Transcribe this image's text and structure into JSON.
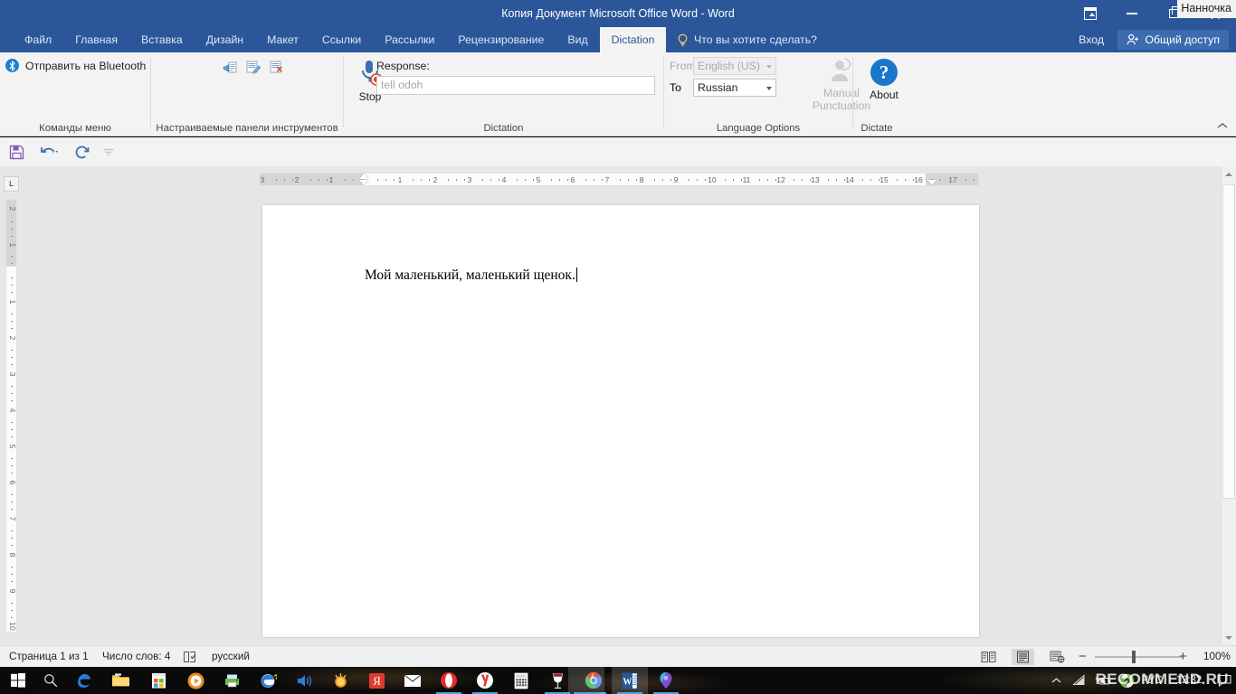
{
  "titlebar": {
    "title": "Копия Документ Microsoft Office Word - Word",
    "name_badge": "Нанночка",
    "ribbon_display_options_icon": "ribbon-display-options-icon",
    "minimize_icon": "minimize-icon",
    "restore_icon": "restore-icon",
    "close_icon": "close-icon"
  },
  "tabs": [
    {
      "label": "Файл",
      "active": false
    },
    {
      "label": "Главная",
      "active": false
    },
    {
      "label": "Вставка",
      "active": false
    },
    {
      "label": "Дизайн",
      "active": false
    },
    {
      "label": "Макет",
      "active": false
    },
    {
      "label": "Ссылки",
      "active": false
    },
    {
      "label": "Рассылки",
      "active": false
    },
    {
      "label": "Рецензирование",
      "active": false
    },
    {
      "label": "Вид",
      "active": false
    },
    {
      "label": "Dictation",
      "active": true
    }
  ],
  "tell_me": {
    "label": "Что вы хотите сделать?",
    "icon": "lightbulb-icon"
  },
  "signin": {
    "label": "Вход"
  },
  "share": {
    "label": "Общий доступ",
    "icon": "share-person-icon"
  },
  "ribbon": {
    "groups": [
      {
        "name": "menu-commands",
        "label": "Команды меню"
      },
      {
        "name": "custom-toolbars",
        "label": "Настраиваемые панели инструментов"
      },
      {
        "name": "dictation",
        "label": "Dictation"
      },
      {
        "name": "language-options",
        "label": "Language Options"
      },
      {
        "name": "dictate",
        "label": "Dictate"
      }
    ],
    "bluetooth": {
      "label": "Отправить на Bluetooth",
      "icon": "bluetooth-icon"
    },
    "custom_toolbar_icons": [
      "send-to-icon",
      "edit-toolbar-icon",
      "delete-toolbar-icon"
    ],
    "dictation": {
      "stop_label": "Stop",
      "stop_icon": "microphone-stop-icon",
      "response_label": "Response:",
      "response_value": "tell odoh"
    },
    "language": {
      "from_label": "From",
      "from_value": "English (US)",
      "to_label": "To",
      "to_value": "Russian",
      "manual_punctuation_line1": "Manual",
      "manual_punctuation_line2": "Punctuation",
      "manual_punctuation_icon": "person-speech-icon"
    },
    "about": {
      "label": "About",
      "icon": "question-mark-icon"
    },
    "collapse_icon": "chevron-up-icon"
  },
  "qat": {
    "save_icon": "save-icon",
    "undo_icon": "undo-icon",
    "undo_dropdown_icon": "chevron-down-icon",
    "redo_icon": "redo-icon",
    "customize_icon": "customize-qat-icon"
  },
  "ruler": {
    "tab_stop_label": "L",
    "horizontal_ticks": [
      "3",
      "2",
      "1",
      "1",
      "2",
      "3",
      "4",
      "5",
      "6",
      "7",
      "8",
      "9",
      "10",
      "11",
      "12",
      "13",
      "14",
      "15",
      "16",
      "17"
    ],
    "vertical_ticks": [
      "2",
      "1",
      "1",
      "2",
      "3",
      "4",
      "5",
      "6",
      "7",
      "8",
      "9",
      "10"
    ],
    "left_indent_marker": "left-indent-marker",
    "right_indent_marker": "right-indent-marker"
  },
  "document": {
    "text": "Мой маленький, маленький щенок."
  },
  "statusbar": {
    "page": "Страница 1 из 1",
    "words": "Число слов: 4",
    "proofing_icon": "proofing-errors-icon",
    "language": "русский",
    "view_read": "read-mode-icon",
    "view_print": "print-layout-icon",
    "view_web": "web-layout-icon",
    "zoom_out": "−",
    "zoom_in": "+",
    "zoom_level": "100%"
  },
  "taskbar": {
    "start_icon": "windows-start-icon",
    "search_icon": "search-icon",
    "items": [
      {
        "name": "edge-icon",
        "running": false
      },
      {
        "name": "file-explorer-icon",
        "running": false
      },
      {
        "name": "microsoft-store-icon",
        "running": false
      },
      {
        "name": "media-player-icon",
        "running": false
      },
      {
        "name": "printer-icon",
        "running": false
      },
      {
        "name": "internet-explorer-icon",
        "running": false
      },
      {
        "name": "volume-app-icon",
        "running": false
      },
      {
        "name": "sun-app-icon",
        "running": false
      },
      {
        "name": "yandex-browser-icon",
        "running": false
      },
      {
        "name": "mail-icon",
        "running": false
      },
      {
        "name": "opera-browser-icon",
        "running": true
      },
      {
        "name": "yandex-disk-icon",
        "running": true
      },
      {
        "name": "calculator-icon",
        "running": false
      },
      {
        "name": "wine-glass-icon",
        "running": true
      },
      {
        "name": "chrome-browser-icon",
        "running": true
      },
      {
        "name": "word-icon",
        "running": true,
        "active": true
      },
      {
        "name": "maps-icon",
        "running": true
      }
    ],
    "tray": {
      "show_hidden_icon": "chevron-up-icon",
      "network_icon": "wifi-icon",
      "power_icon": "battery-icon",
      "app_icon": "tray-app-icon",
      "language": "РУС",
      "time": "12:32",
      "action_center_icon": "action-center-icon"
    }
  },
  "watermark": {
    "text": "RECOMMEND.RU"
  }
}
